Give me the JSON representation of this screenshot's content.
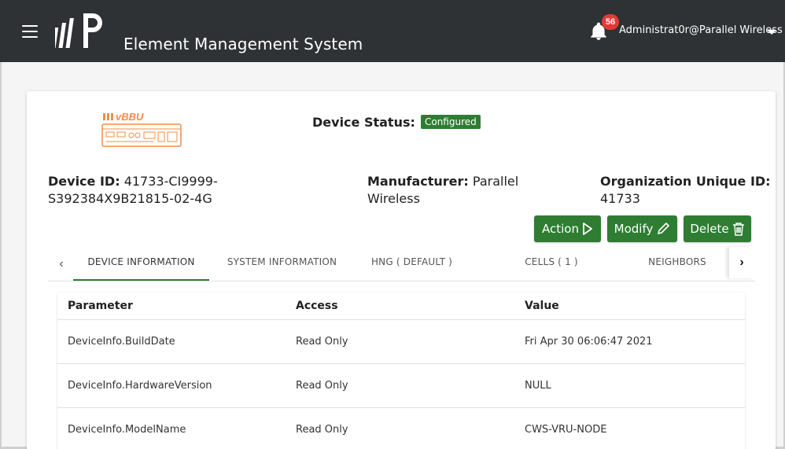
{
  "header": {
    "title": "Element Management System",
    "notification_count": "56",
    "user": "Administrat0r@Parallel Wireless"
  },
  "device": {
    "image_label": "vBBU",
    "status_label": "Device Status:",
    "status_value": "Configured",
    "id_label": "Device ID:",
    "id_value": "41733-CI9999-S392384X9B21815-02-4G",
    "manufacturer_label": "Manufacturer:",
    "manufacturer_value": "Parallel Wireless",
    "org_label": "Organization Unique ID:",
    "org_value": "41733"
  },
  "actions": {
    "action_label": "Action",
    "modify_label": "Modify",
    "delete_label": "Delete"
  },
  "tabs": [
    {
      "label": "DEVICE INFORMATION",
      "active": true
    },
    {
      "label": "SYSTEM INFORMATION",
      "active": false
    },
    {
      "label": "HNG ( DEFAULT )",
      "active": false
    },
    {
      "label": "CELLS ( 1 )",
      "active": false
    },
    {
      "label": "NEIGHBORS",
      "active": false
    }
  ],
  "table": {
    "columns": [
      "Parameter",
      "Access",
      "Value"
    ],
    "rows": [
      [
        "DeviceInfo.BuildDate",
        "Read Only",
        "Fri Apr 30 06:06:47 2021"
      ],
      [
        "DeviceInfo.HardwareVersion",
        "Read Only",
        "NULL"
      ],
      [
        "DeviceInfo.ModelName",
        "Read Only",
        "CWS-VRU-NODE"
      ]
    ]
  },
  "colors": {
    "topbar": "#2f3234",
    "accent_green": "#2e7d32",
    "badge_red": "#e53935",
    "device_orange": "#f28c4a"
  },
  "icons": [
    "menu-icon",
    "logo-icon",
    "bell-icon",
    "chevron-down-icon",
    "play-icon",
    "pencil-icon",
    "trash-icon",
    "chevron-left-icon",
    "chevron-right-icon"
  ]
}
